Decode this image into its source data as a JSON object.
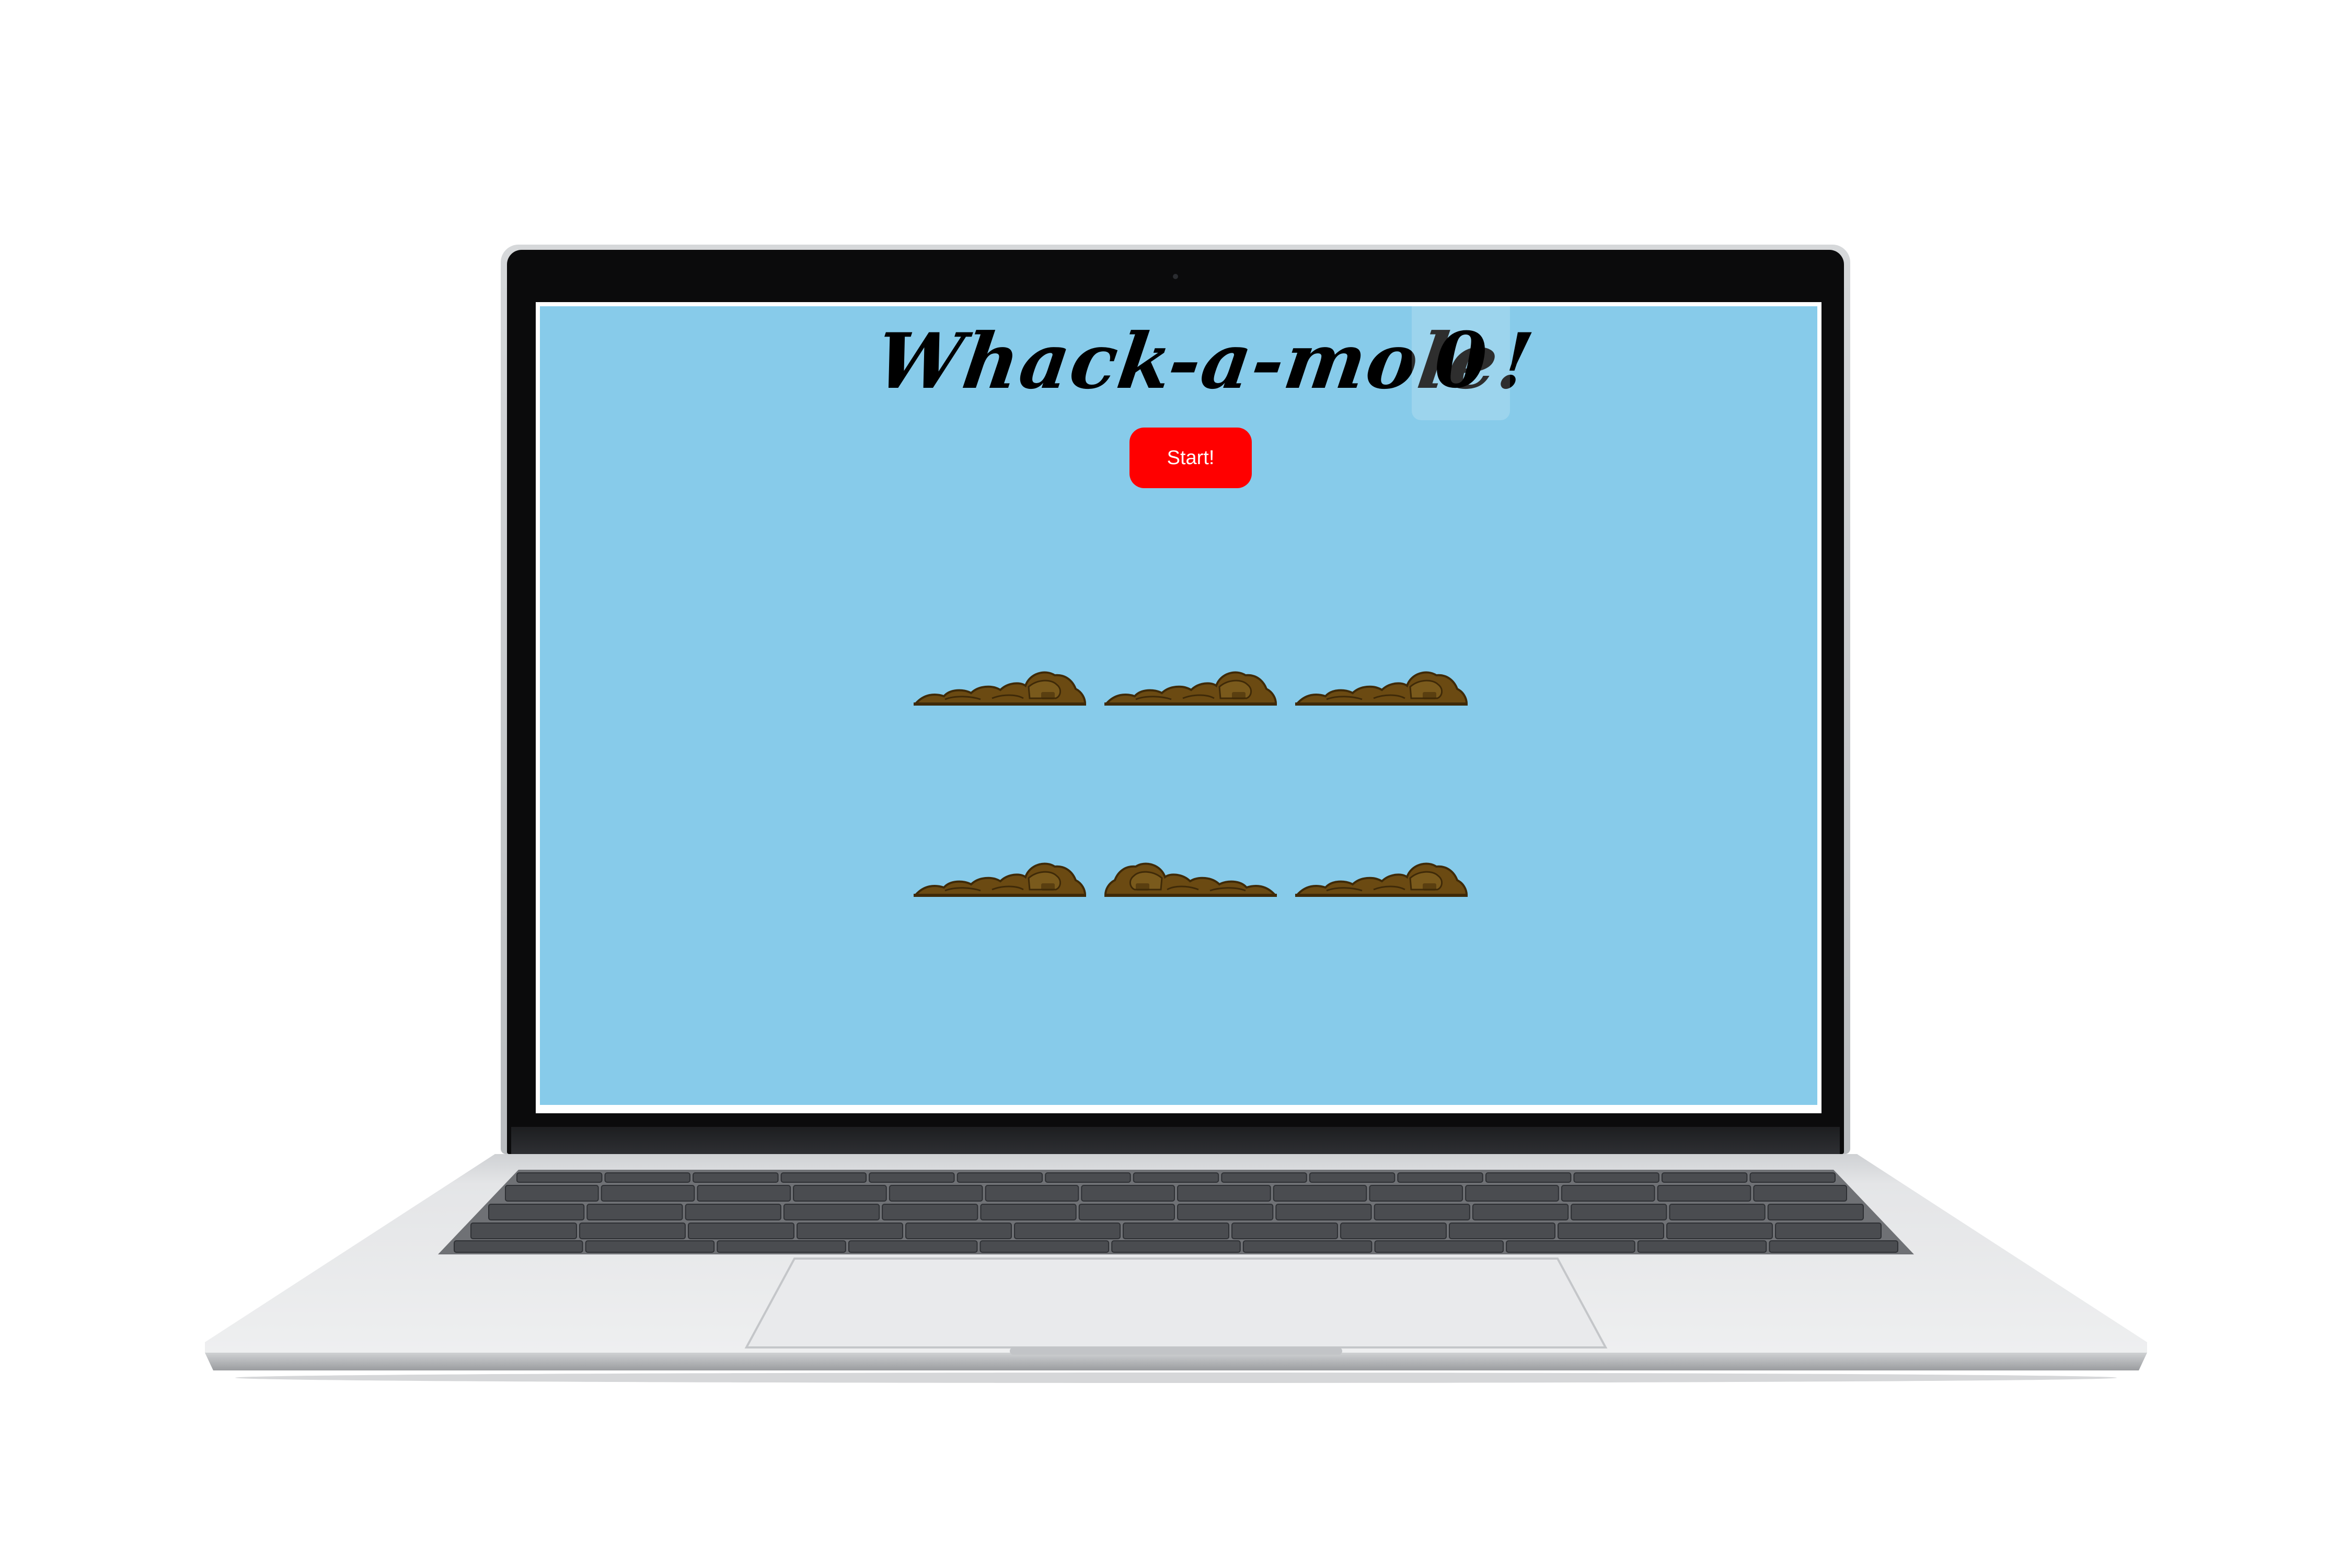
{
  "game": {
    "title": "Whack-a-mole!",
    "score": "0",
    "start_label": "Start!"
  },
  "holes": [
    {
      "id": 1,
      "mole_visible": false
    },
    {
      "id": 2,
      "mole_visible": false
    },
    {
      "id": 3,
      "mole_visible": false
    },
    {
      "id": 4,
      "mole_visible": false
    },
    {
      "id": 5,
      "mole_visible": false
    },
    {
      "id": 6,
      "mole_visible": false
    }
  ],
  "colors": {
    "background": "#87cbea",
    "start_button": "#ff0000",
    "dirt": "#6b4a12",
    "dirt_dark": "#3f2a08"
  }
}
